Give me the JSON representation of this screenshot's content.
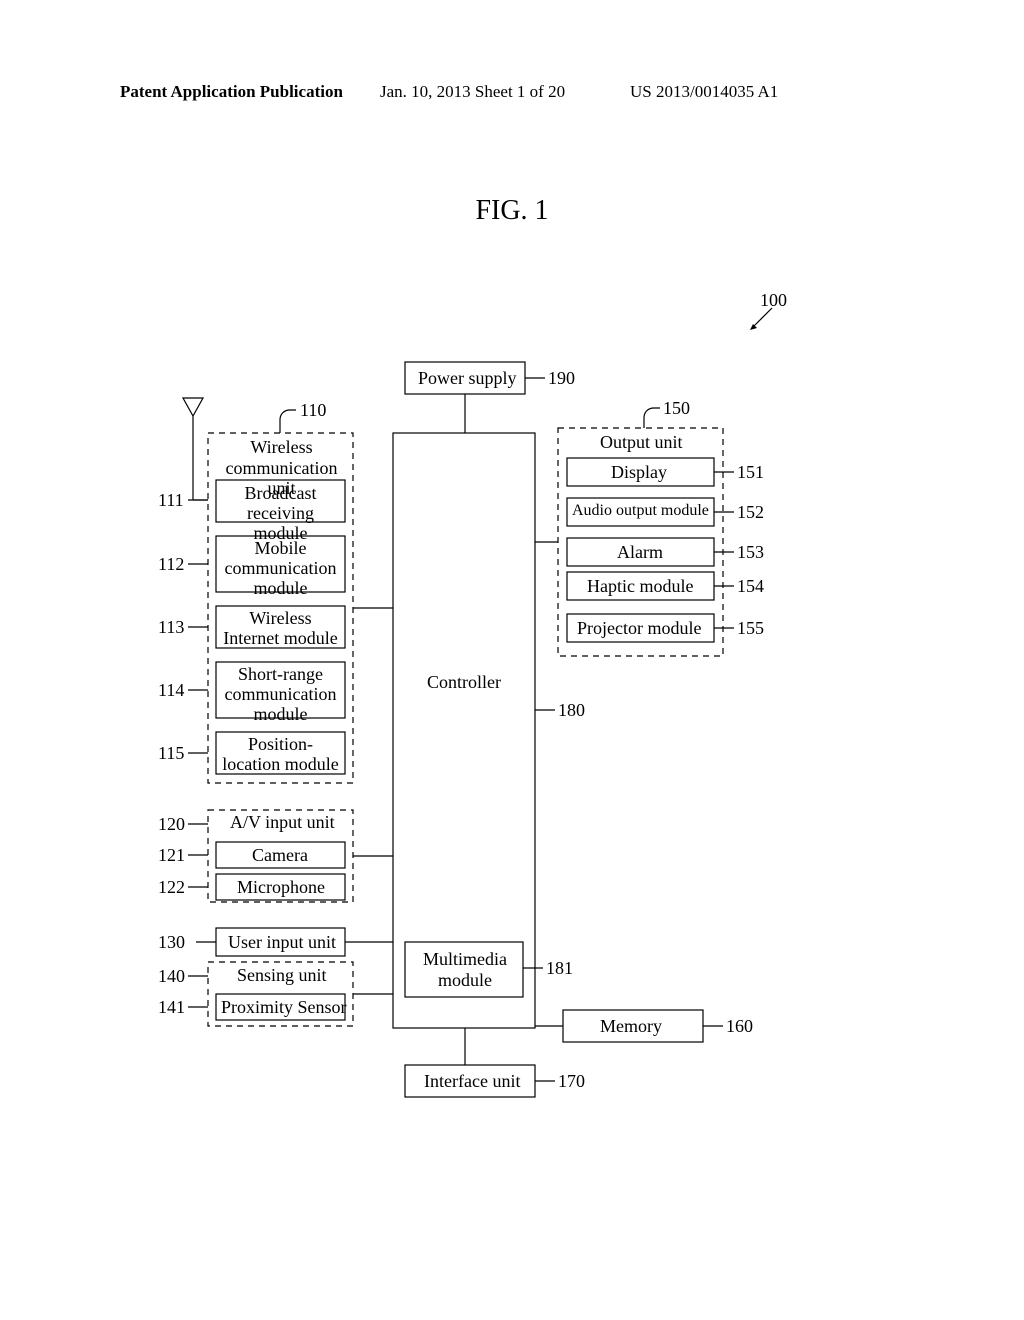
{
  "header": {
    "left": "Patent Application Publication",
    "center": "Jan. 10, 2013  Sheet 1 of 20",
    "right": "US 2013/0014035 A1"
  },
  "figure_label": "FIG. 1",
  "device_ref": "100",
  "wireless_unit": {
    "ref": "110",
    "title": "Wireless\ncommunication unit",
    "children": [
      {
        "ref": "111",
        "label": "Broadcast\nreceiving module"
      },
      {
        "ref": "112",
        "label": "Mobile\ncommunication\nmodule"
      },
      {
        "ref": "113",
        "label": "Wireless\nInternet module"
      },
      {
        "ref": "114",
        "label": "Short-range\ncommunication\nmodule"
      },
      {
        "ref": "115",
        "label": "Position-location\nmodule"
      }
    ]
  },
  "av_input": {
    "ref": "120",
    "title": "A/V input unit",
    "children": [
      {
        "ref": "121",
        "label": "Camera"
      },
      {
        "ref": "122",
        "label": "Microphone"
      }
    ]
  },
  "user_input": {
    "ref": "130",
    "label": "User input unit"
  },
  "sensing_unit": {
    "ref": "140",
    "title": "Sensing unit",
    "children": [
      {
        "ref": "141",
        "label": "Proximity Sensor"
      }
    ]
  },
  "power_supply": {
    "ref": "190",
    "label": "Power supply"
  },
  "controller": {
    "ref": "180",
    "label": "Controller"
  },
  "multimedia": {
    "ref": "181",
    "label": "Multimedia\nmodule"
  },
  "output_unit": {
    "ref": "150",
    "title": "Output unit",
    "children": [
      {
        "ref": "151",
        "label": "Display"
      },
      {
        "ref": "152",
        "label": "Audio output module"
      },
      {
        "ref": "153",
        "label": "Alarm"
      },
      {
        "ref": "154",
        "label": "Haptic module"
      },
      {
        "ref": "155",
        "label": "Projector module"
      }
    ]
  },
  "memory": {
    "ref": "160",
    "label": "Memory"
  },
  "interface": {
    "ref": "170",
    "label": "Interface unit"
  }
}
